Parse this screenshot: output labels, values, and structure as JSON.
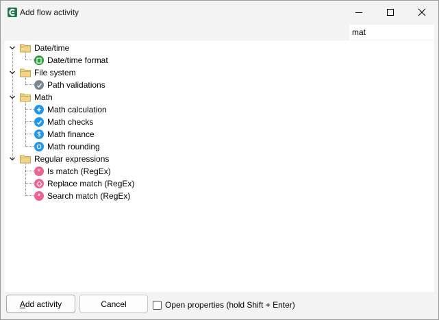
{
  "window": {
    "title": "Add flow activity",
    "minimize_label": "Minimize",
    "maximize_label": "Maximize",
    "close_label": "Close"
  },
  "search": {
    "value": "mat",
    "placeholder": ""
  },
  "tree": {
    "categories": [
      {
        "label": "Date/time",
        "expanded": true,
        "items": [
          {
            "label": "Date/time format",
            "icon": "date-format-icon",
            "color": "#2e9b3a"
          }
        ]
      },
      {
        "label": "File system",
        "expanded": true,
        "items": [
          {
            "label": "Path validations",
            "icon": "path-validation-icon",
            "color": "#7b8794"
          }
        ]
      },
      {
        "label": "Math",
        "expanded": true,
        "items": [
          {
            "label": "Math calculation",
            "icon": "plus-icon",
            "color": "#2196f3"
          },
          {
            "label": "Math checks",
            "icon": "checkmark-icon",
            "color": "#2196f3"
          },
          {
            "label": "Math finance",
            "icon": "dollar-icon",
            "color": "#2196f3"
          },
          {
            "label": "Math rounding",
            "icon": "rounding-icon",
            "color": "#2196f3"
          }
        ]
      },
      {
        "label": "Regular expressions",
        "expanded": true,
        "items": [
          {
            "label": "Is match (RegEx)",
            "icon": "regex-match-icon",
            "color": "#f06292"
          },
          {
            "label": "Replace match (RegEx)",
            "icon": "regex-replace-icon",
            "color": "#f06292"
          },
          {
            "label": "Search match (RegEx)",
            "icon": "regex-search-icon",
            "color": "#f06292"
          }
        ]
      }
    ]
  },
  "footer": {
    "add_label_prefix": "A",
    "add_label_rest": "dd activity",
    "cancel_label": "Cancel",
    "open_properties_label": "Open properties (hold Shift + Enter)",
    "open_properties_checked": false
  },
  "colors": {
    "folder": "#e8c774",
    "folder_dark": "#c9a44a"
  }
}
